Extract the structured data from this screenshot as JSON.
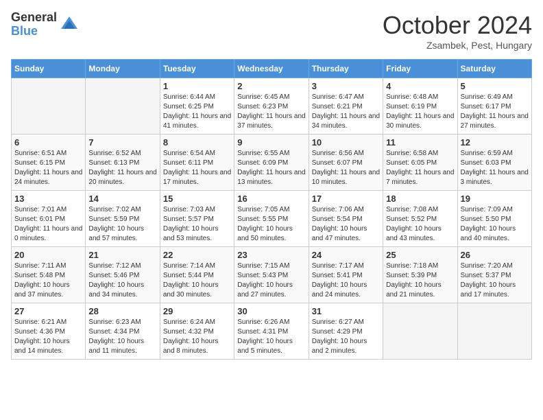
{
  "logo": {
    "general": "General",
    "blue": "Blue"
  },
  "header": {
    "month": "October 2024",
    "location": "Zsambek, Pest, Hungary"
  },
  "days_of_week": [
    "Sunday",
    "Monday",
    "Tuesday",
    "Wednesday",
    "Thursday",
    "Friday",
    "Saturday"
  ],
  "weeks": [
    [
      {
        "day": "",
        "info": ""
      },
      {
        "day": "",
        "info": ""
      },
      {
        "day": "1",
        "info": "Sunrise: 6:44 AM\nSunset: 6:25 PM\nDaylight: 11 hours and 41 minutes."
      },
      {
        "day": "2",
        "info": "Sunrise: 6:45 AM\nSunset: 6:23 PM\nDaylight: 11 hours and 37 minutes."
      },
      {
        "day": "3",
        "info": "Sunrise: 6:47 AM\nSunset: 6:21 PM\nDaylight: 11 hours and 34 minutes."
      },
      {
        "day": "4",
        "info": "Sunrise: 6:48 AM\nSunset: 6:19 PM\nDaylight: 11 hours and 30 minutes."
      },
      {
        "day": "5",
        "info": "Sunrise: 6:49 AM\nSunset: 6:17 PM\nDaylight: 11 hours and 27 minutes."
      }
    ],
    [
      {
        "day": "6",
        "info": "Sunrise: 6:51 AM\nSunset: 6:15 PM\nDaylight: 11 hours and 24 minutes."
      },
      {
        "day": "7",
        "info": "Sunrise: 6:52 AM\nSunset: 6:13 PM\nDaylight: 11 hours and 20 minutes."
      },
      {
        "day": "8",
        "info": "Sunrise: 6:54 AM\nSunset: 6:11 PM\nDaylight: 11 hours and 17 minutes."
      },
      {
        "day": "9",
        "info": "Sunrise: 6:55 AM\nSunset: 6:09 PM\nDaylight: 11 hours and 13 minutes."
      },
      {
        "day": "10",
        "info": "Sunrise: 6:56 AM\nSunset: 6:07 PM\nDaylight: 11 hours and 10 minutes."
      },
      {
        "day": "11",
        "info": "Sunrise: 6:58 AM\nSunset: 6:05 PM\nDaylight: 11 hours and 7 minutes."
      },
      {
        "day": "12",
        "info": "Sunrise: 6:59 AM\nSunset: 6:03 PM\nDaylight: 11 hours and 3 minutes."
      }
    ],
    [
      {
        "day": "13",
        "info": "Sunrise: 7:01 AM\nSunset: 6:01 PM\nDaylight: 11 hours and 0 minutes."
      },
      {
        "day": "14",
        "info": "Sunrise: 7:02 AM\nSunset: 5:59 PM\nDaylight: 10 hours and 57 minutes."
      },
      {
        "day": "15",
        "info": "Sunrise: 7:03 AM\nSunset: 5:57 PM\nDaylight: 10 hours and 53 minutes."
      },
      {
        "day": "16",
        "info": "Sunrise: 7:05 AM\nSunset: 5:55 PM\nDaylight: 10 hours and 50 minutes."
      },
      {
        "day": "17",
        "info": "Sunrise: 7:06 AM\nSunset: 5:54 PM\nDaylight: 10 hours and 47 minutes."
      },
      {
        "day": "18",
        "info": "Sunrise: 7:08 AM\nSunset: 5:52 PM\nDaylight: 10 hours and 43 minutes."
      },
      {
        "day": "19",
        "info": "Sunrise: 7:09 AM\nSunset: 5:50 PM\nDaylight: 10 hours and 40 minutes."
      }
    ],
    [
      {
        "day": "20",
        "info": "Sunrise: 7:11 AM\nSunset: 5:48 PM\nDaylight: 10 hours and 37 minutes."
      },
      {
        "day": "21",
        "info": "Sunrise: 7:12 AM\nSunset: 5:46 PM\nDaylight: 10 hours and 34 minutes."
      },
      {
        "day": "22",
        "info": "Sunrise: 7:14 AM\nSunset: 5:44 PM\nDaylight: 10 hours and 30 minutes."
      },
      {
        "day": "23",
        "info": "Sunrise: 7:15 AM\nSunset: 5:43 PM\nDaylight: 10 hours and 27 minutes."
      },
      {
        "day": "24",
        "info": "Sunrise: 7:17 AM\nSunset: 5:41 PM\nDaylight: 10 hours and 24 minutes."
      },
      {
        "day": "25",
        "info": "Sunrise: 7:18 AM\nSunset: 5:39 PM\nDaylight: 10 hours and 21 minutes."
      },
      {
        "day": "26",
        "info": "Sunrise: 7:20 AM\nSunset: 5:37 PM\nDaylight: 10 hours and 17 minutes."
      }
    ],
    [
      {
        "day": "27",
        "info": "Sunrise: 6:21 AM\nSunset: 4:36 PM\nDaylight: 10 hours and 14 minutes."
      },
      {
        "day": "28",
        "info": "Sunrise: 6:23 AM\nSunset: 4:34 PM\nDaylight: 10 hours and 11 minutes."
      },
      {
        "day": "29",
        "info": "Sunrise: 6:24 AM\nSunset: 4:32 PM\nDaylight: 10 hours and 8 minutes."
      },
      {
        "day": "30",
        "info": "Sunrise: 6:26 AM\nSunset: 4:31 PM\nDaylight: 10 hours and 5 minutes."
      },
      {
        "day": "31",
        "info": "Sunrise: 6:27 AM\nSunset: 4:29 PM\nDaylight: 10 hours and 2 minutes."
      },
      {
        "day": "",
        "info": ""
      },
      {
        "day": "",
        "info": ""
      }
    ]
  ]
}
